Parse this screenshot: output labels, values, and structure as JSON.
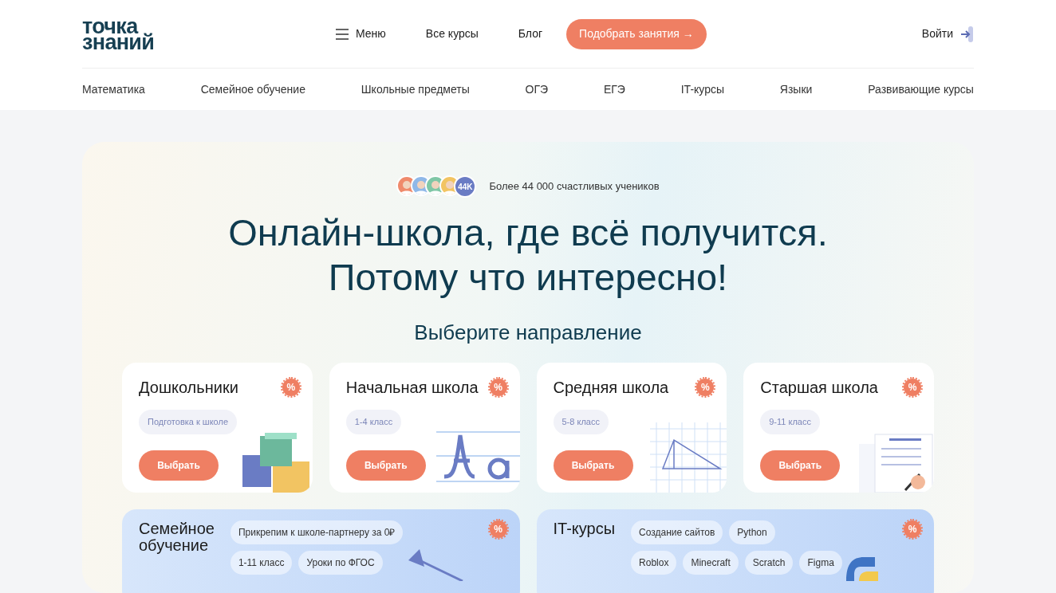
{
  "header": {
    "logo_lines": [
      "точка",
      "знаний"
    ],
    "menu": "Меню",
    "links": [
      "Все курсы",
      "Блог"
    ],
    "cta": "Подобрать занятия",
    "cta_arrow": "→",
    "login": "Войти"
  },
  "categories": [
    "Математика",
    "Семейное обучение",
    "Школьные предметы",
    "ОГЭ",
    "ЕГЭ",
    "IT-курсы",
    "Языки",
    "Развивающие курсы"
  ],
  "hero": {
    "avatars": [
      {
        "color": "#ef8a6b"
      },
      {
        "color": "#8fb8e8"
      },
      {
        "color": "#7fc7a6"
      },
      {
        "color": "#f2c462"
      }
    ],
    "count_badge": "44K",
    "students": "Более 44 000 счастливых учеников",
    "title_lines": [
      "Онлайн-школа, где всё получится.",
      "Потому что интересно!"
    ],
    "subtitle": "Выберите направление"
  },
  "directions": [
    {
      "title": "Дошкольники",
      "discount": "%",
      "tag": "Подготовка к школе",
      "button": "Выбрать",
      "kind": "blocks"
    },
    {
      "title": "Начальная школа",
      "discount": "%",
      "tag": "1-4 класс",
      "button": "Выбрать",
      "kind": "letters"
    },
    {
      "title": "Средняя школа",
      "discount": "%",
      "tag": "5-8 класс",
      "button": "Выбрать",
      "kind": "triangle"
    },
    {
      "title": "Старшая школа",
      "discount": "%",
      "tag": "9-11 класс",
      "button": "Выбрать",
      "kind": "papers"
    }
  ],
  "wide_directions": [
    {
      "title_lines": [
        "Семейное",
        "обучение"
      ],
      "discount": "%",
      "tag_rows": [
        [
          "Прикрепим к школе-партнеру за 0₽"
        ],
        [
          "1-11 класс",
          "Уроки по ФГОС"
        ]
      ],
      "kind": "lamp"
    },
    {
      "title_lines": [
        "IT-курсы"
      ],
      "discount": "%",
      "tag_rows": [
        [
          "Создание сайтов",
          "Python"
        ],
        [
          "Roblox",
          "Minecraft",
          "Scratch",
          "Figma"
        ]
      ],
      "kind": "python"
    }
  ]
}
